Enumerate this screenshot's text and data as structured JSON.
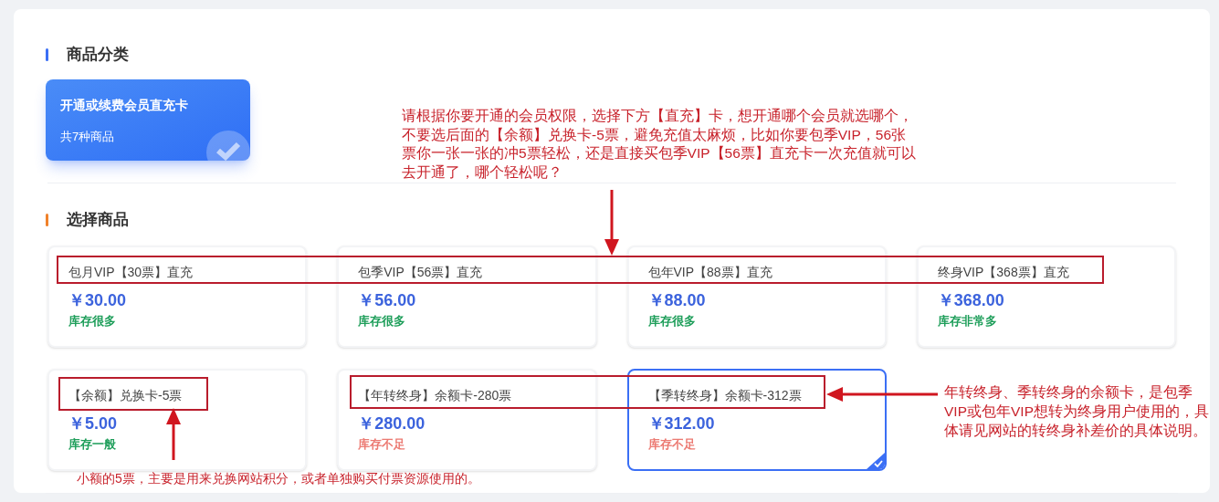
{
  "category_section": {
    "title": "商品分类",
    "categories": [
      {
        "name": "开通或续费会员直充卡",
        "count": "共7种商品",
        "selected": true
      }
    ]
  },
  "product_section": {
    "title": "选择商品",
    "products": [
      {
        "name": "包月VIP【30票】直充",
        "price": "￥30.00",
        "stock": "库存很多",
        "color": "#1e9e5a",
        "selected": false
      },
      {
        "name": "包季VIP【56票】直充",
        "price": "￥56.00",
        "stock": "库存很多",
        "color": "#1e9e5a",
        "selected": false
      },
      {
        "name": "包年VIP【88票】直充",
        "price": "￥88.00",
        "stock": "库存很多",
        "color": "#1e9e5a",
        "selected": false
      },
      {
        "name": "终身VIP【368票】直充",
        "price": "￥368.00",
        "stock": "库存非常多",
        "color": "#1e9e5a",
        "selected": false
      },
      {
        "name": "【余额】兑换卡-5票",
        "price": "￥5.00",
        "stock": "库存一般",
        "color": "#1e9e5a",
        "selected": false
      },
      {
        "name": "【年转终身】余额卡-280票",
        "price": "￥280.00",
        "stock": "库存不足",
        "color": "#ec7a72",
        "selected": false
      },
      {
        "name": "【季转终身】余额卡-312票",
        "price": "￥312.00",
        "stock": "库存不足",
        "color": "#ec7a72",
        "selected": true
      }
    ]
  },
  "annotations": [
    {
      "text": "请根据你要开通的会员权限，选择下方【直充】卡，想开通哪个会员就选哪个，不要选后面的【余额】兑换卡-5票，避免充值太麻烦，比如你要包季VIP，56张票你一张一张的冲5票轻松，还是直接买包季VIP【56票】直充卡一次充值就可以去开通了，哪个轻松呢？"
    },
    {
      "text": "年转终身、季转终身的余额卡，是包季VIP或包年VIP想转为终身用户使用的，具体请见网站的转终身补差价的具体说明。"
    },
    {
      "text": "小额的5票，主要是用来兑换网站积分，或者单独购买付票资源使用的。"
    }
  ]
}
